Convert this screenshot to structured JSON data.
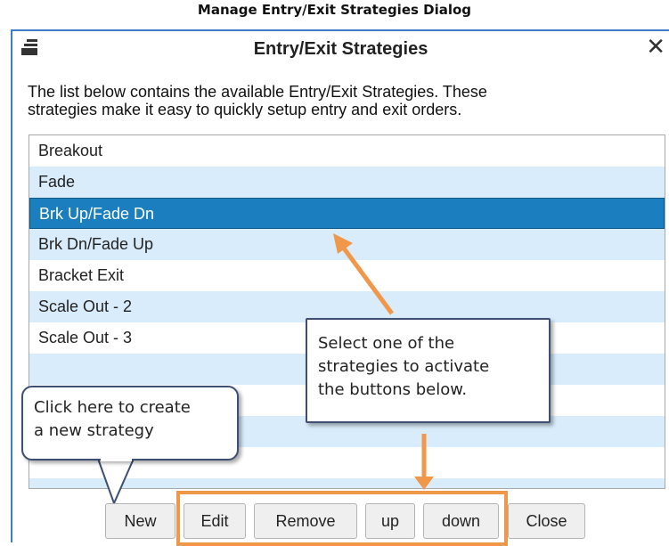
{
  "caption": "Manage Entry/Exit Strategies Dialog",
  "dialog": {
    "title": "Entry/Exit Strategies",
    "close_glyph": "✕",
    "description_line1": "The list below contains the available Entry/Exit Strategies.  These",
    "description_line2": "strategies make it easy to quickly setup entry and exit orders.",
    "strategies": [
      "Breakout",
      "Fade",
      "Brk Up/Fade Dn",
      "Brk Dn/Fade Up",
      "Bracket Exit",
      "Scale Out - 2",
      "Scale Out - 3"
    ],
    "selected": "Brk Up/Fade Dn",
    "buttons": {
      "new": "New",
      "edit": "Edit",
      "remove": "Remove",
      "up": "up",
      "down": "down",
      "close": "Close"
    }
  },
  "callouts": {
    "select_line1": "Select one of the",
    "select_line2": "strategies to activate",
    "select_line3": "the buttons below.",
    "create_line1": "Click here to create",
    "create_line2": "a new strategy"
  },
  "colors": {
    "accent": "#1b7fbf",
    "row_alt": "#d9ecfb",
    "annotation": "#f0974a",
    "callout_border": "#3d4f73"
  },
  "icons": {
    "app": "window-stack-icon",
    "close": "close-icon"
  }
}
